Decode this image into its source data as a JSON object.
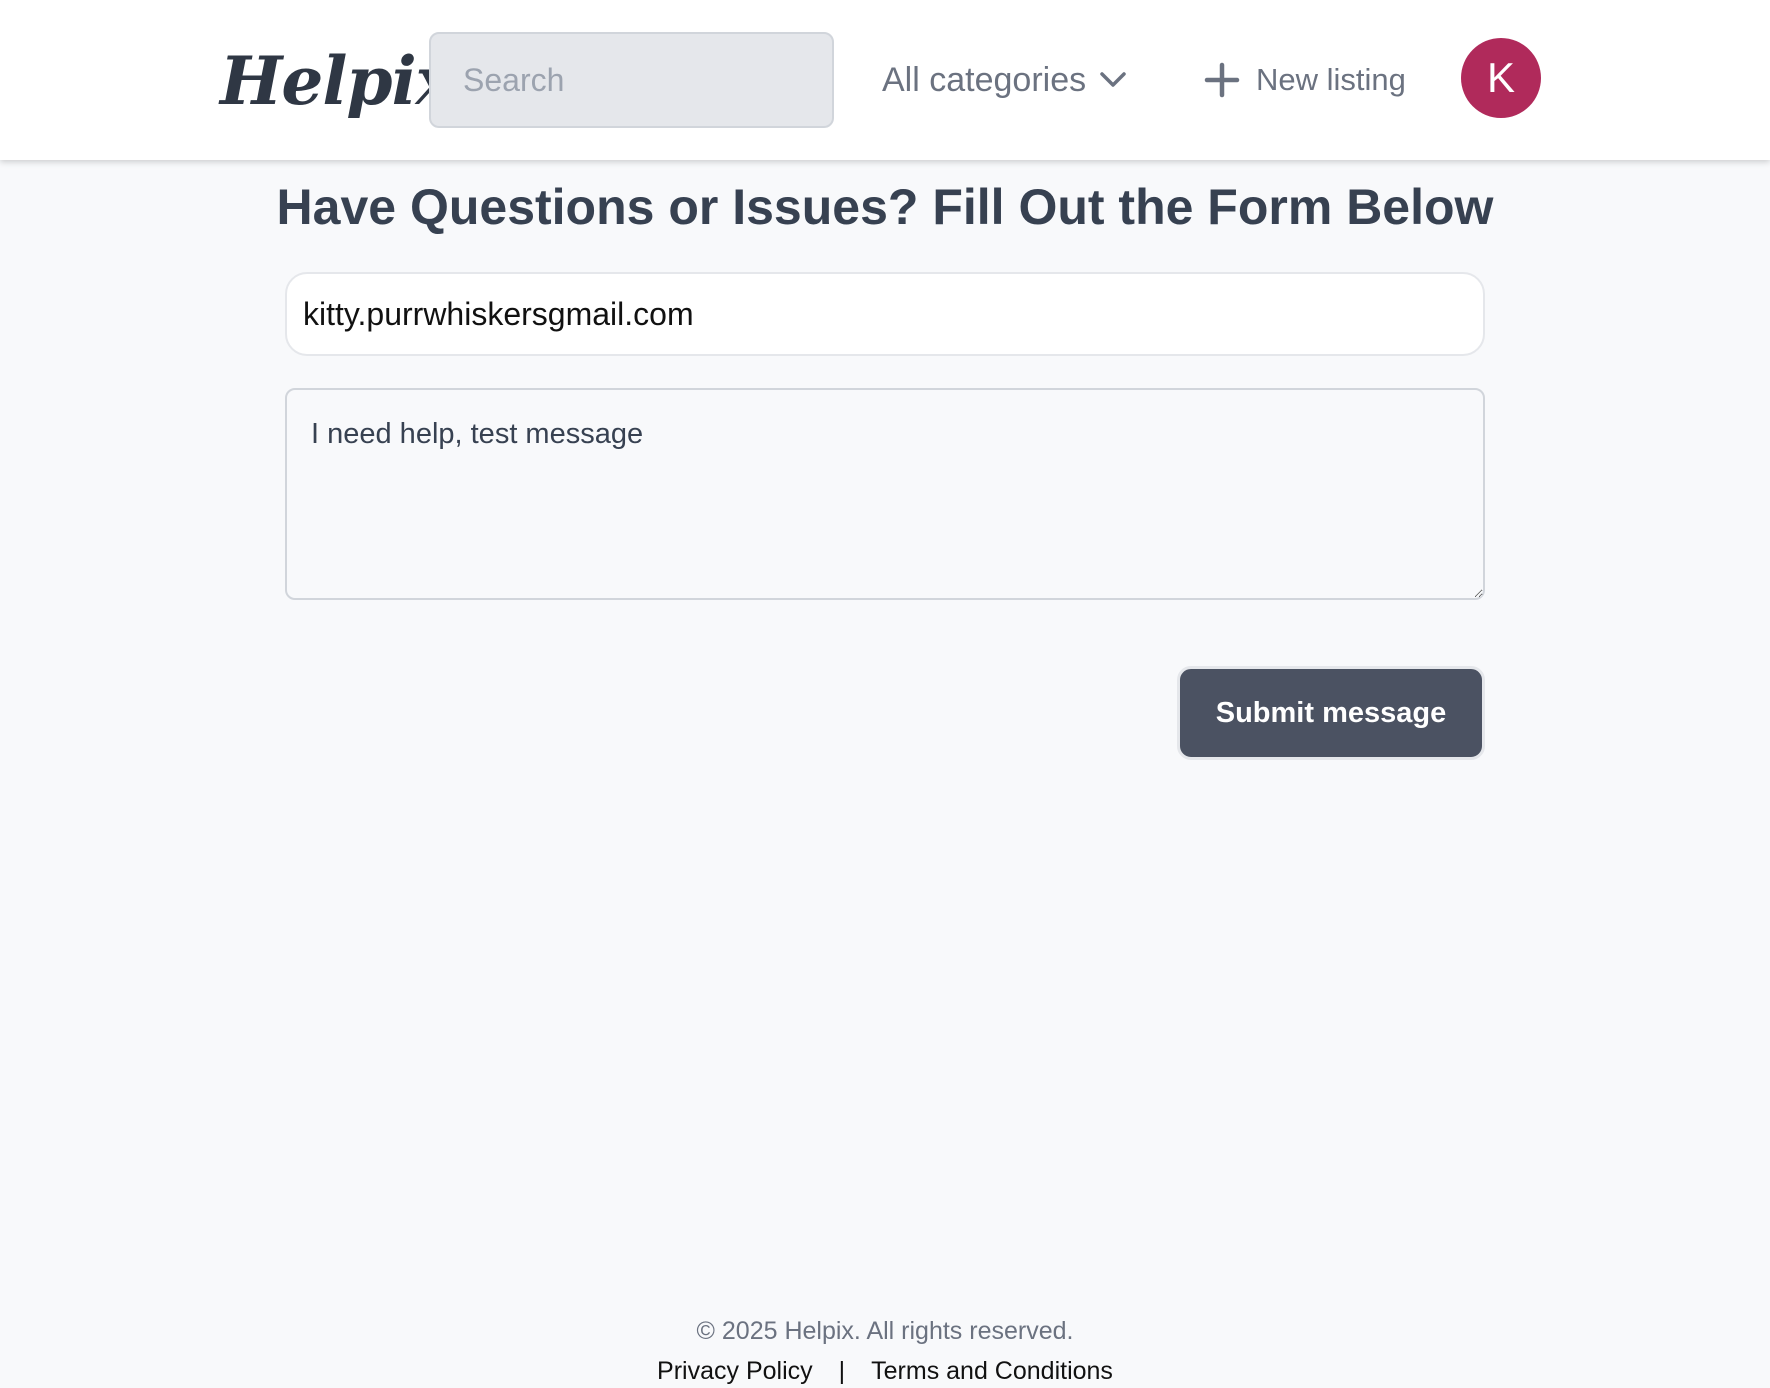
{
  "header": {
    "logo": "Helpix",
    "search_placeholder": "Search",
    "categories_label": "All categories",
    "new_listing_label": "New listing",
    "avatar_initial": "K",
    "avatar_color": "#b02a5b"
  },
  "main": {
    "title": "Have Questions or Issues? Fill Out the Form Below",
    "email_value": "kitty.purrwhiskersgmail.com",
    "message_value": "I need help, test message",
    "submit_label": "Submit message",
    "submit_color": "#4b5262"
  },
  "footer": {
    "copyright": "© 2025 Helpix. All rights reserved.",
    "privacy_label": "Privacy Policy",
    "separator": "|",
    "terms_label": "Terms and Conditions"
  }
}
